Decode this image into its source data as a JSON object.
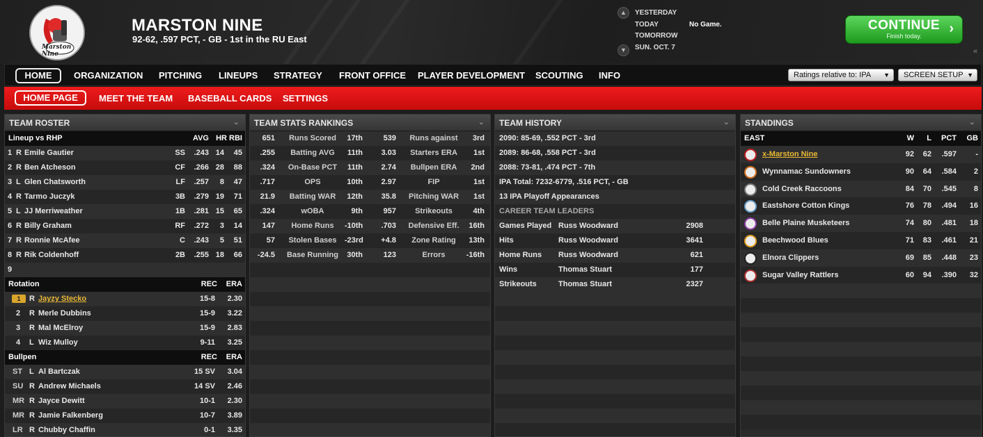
{
  "header": {
    "team_name": "MARSTON NINE",
    "record": "92-62, .597 PCT, - GB - 1st in the RU East",
    "logo_text": "Marston Nine",
    "days": [
      "YESTERDAY",
      "TODAY",
      "TOMORROW",
      "SUN. OCT. 7"
    ],
    "today_status": "No Game.",
    "continue_label": "CONTINUE",
    "continue_sub": "Finish today."
  },
  "nav": {
    "items": [
      "HOME",
      "ORGANIZATION",
      "PITCHING",
      "LINEUPS",
      "STRATEGY",
      "FRONT OFFICE",
      "PLAYER DEVELOPMENT",
      "SCOUTING",
      "INFO"
    ],
    "ratings_select": "Ratings relative to: IPA",
    "screen_setup": "SCREEN SETUP"
  },
  "subnav": {
    "items": [
      "HOME PAGE",
      "MEET THE TEAM",
      "BASEBALL CARDS",
      "SETTINGS"
    ]
  },
  "roster": {
    "title": "TEAM ROSTER",
    "lineup_header": [
      "Lineup vs RHP",
      "AVG",
      "HR",
      "RBI"
    ],
    "lineup": [
      [
        "1",
        "R",
        "Emile Gautier",
        "SS",
        ".243",
        "14",
        "45"
      ],
      [
        "2",
        "R",
        "Ben Atcheson",
        "CF",
        ".266",
        "28",
        "88"
      ],
      [
        "3",
        "L",
        "Glen Chatsworth",
        "LF",
        ".257",
        "8",
        "47"
      ],
      [
        "4",
        "R",
        "Tarmo Juczyk",
        "3B",
        ".279",
        "19",
        "71"
      ],
      [
        "5",
        "L",
        "JJ Merriweather",
        "1B",
        ".281",
        "15",
        "65"
      ],
      [
        "6",
        "R",
        "Billy Graham",
        "RF",
        ".272",
        "3",
        "14"
      ],
      [
        "7",
        "R",
        "Ronnie McAfee",
        "C",
        ".243",
        "5",
        "51"
      ],
      [
        "8",
        "R",
        "Rik Coldenhoff",
        "2B",
        ".255",
        "18",
        "66"
      ],
      [
        "9",
        "",
        "",
        "",
        "",
        "",
        ""
      ]
    ],
    "rotation_header": [
      "Rotation",
      "REC",
      "ERA"
    ],
    "rotation": [
      [
        "1",
        "R",
        "Jayzy Stecko",
        "15-8",
        "2.30"
      ],
      [
        "2",
        "R",
        "Merle Dubbins",
        "15-9",
        "3.22"
      ],
      [
        "3",
        "R",
        "Mal McElroy",
        "15-9",
        "2.83"
      ],
      [
        "4",
        "L",
        "Wiz Mulloy",
        "9-11",
        "3.25"
      ]
    ],
    "bullpen_header": [
      "Bullpen",
      "REC",
      "ERA"
    ],
    "bullpen": [
      [
        "ST",
        "L",
        "Al Bartczak",
        "15 SV",
        "3.04"
      ],
      [
        "SU",
        "R",
        "Andrew Michaels",
        "14 SV",
        "2.46"
      ],
      [
        "MR",
        "R",
        "Jayce Dewitt",
        "10-1",
        "2.30"
      ],
      [
        "MR",
        "R",
        "Jamie Falkenberg",
        "10-7",
        "3.89"
      ],
      [
        "LR",
        "R",
        "Chubby Chaffin",
        "0-1",
        "3.35"
      ]
    ]
  },
  "stats": {
    "title": "TEAM STATS RANKINGS",
    "rows": [
      [
        "651",
        "Runs Scored",
        "17th",
        "539",
        "Runs against",
        "3rd"
      ],
      [
        ".255",
        "Batting AVG",
        "11th",
        "3.03",
        "Starters ERA",
        "1st"
      ],
      [
        ".324",
        "On-Base PCT",
        "11th",
        "2.74",
        "Bullpen ERA",
        "2nd"
      ],
      [
        ".717",
        "OPS",
        "10th",
        "2.97",
        "FIP",
        "1st"
      ],
      [
        "21.9",
        "Batting WAR",
        "12th",
        "35.8",
        "Pitching WAR",
        "1st"
      ],
      [
        ".324",
        "wOBA",
        "9th",
        "957",
        "Strikeouts",
        "4th"
      ],
      [
        "147",
        "Home Runs",
        "-10th",
        ".703",
        "Defensive Eff.",
        "16th"
      ],
      [
        "57",
        "Stolen Bases",
        "-23rd",
        "+4.8",
        "Zone Rating",
        "13th"
      ],
      [
        "-24.5",
        "Base Running",
        "30th",
        "123",
        "Errors",
        "-16th"
      ]
    ]
  },
  "history": {
    "title": "TEAM HISTORY",
    "lines": [
      "2090: 85-69, .552 PCT - 3rd",
      "2089: 86-68, .558 PCT - 3rd",
      "2088: 73-81, .474 PCT - 7th",
      "IPA Total: 7232-6779, .516 PCT, - GB",
      "13 IPA Playoff Appearances"
    ],
    "leaders_title": "CAREER TEAM LEADERS",
    "leaders": [
      [
        "Games Played",
        "Russ Woodward",
        "2908"
      ],
      [
        "Hits",
        "Russ Woodward",
        "3641"
      ],
      [
        "Home Runs",
        "Russ Woodward",
        "621"
      ],
      [
        "Wins",
        "Thomas Stuart",
        "177"
      ],
      [
        "Strikeouts",
        "Thomas Stuart",
        "2327"
      ]
    ]
  },
  "standings": {
    "title": "STANDINGS",
    "header": [
      "EAST",
      "W",
      "L",
      "PCT",
      "GB"
    ],
    "teams": [
      {
        "name": "x-Marston Nine",
        "w": "92",
        "l": "62",
        "pct": ".597",
        "gb": "-",
        "color": "#c02020"
      },
      {
        "name": "Wynnamac Sundowners",
        "w": "90",
        "l": "64",
        "pct": ".584",
        "gb": "2",
        "color": "#d07020"
      },
      {
        "name": "Cold Creek Raccoons",
        "w": "84",
        "l": "70",
        "pct": ".545",
        "gb": "8",
        "color": "#777777"
      },
      {
        "name": "Eastshore Cotton Kings",
        "w": "76",
        "l": "78",
        "pct": ".494",
        "gb": "16",
        "color": "#6aa0c8"
      },
      {
        "name": "Belle Plaine Musketeers",
        "w": "74",
        "l": "80",
        "pct": ".481",
        "gb": "18",
        "color": "#8a3aa0"
      },
      {
        "name": "Beechwood Blues",
        "w": "71",
        "l": "83",
        "pct": ".461",
        "gb": "21",
        "color": "#e0a020"
      },
      {
        "name": "Elnora Clippers",
        "w": "69",
        "l": "85",
        "pct": ".448",
        "gb": "23",
        "color": "#222222"
      },
      {
        "name": "Sugar Valley Rattlers",
        "w": "60",
        "l": "94",
        "pct": ".390",
        "gb": "32",
        "color": "#b03030"
      }
    ]
  }
}
